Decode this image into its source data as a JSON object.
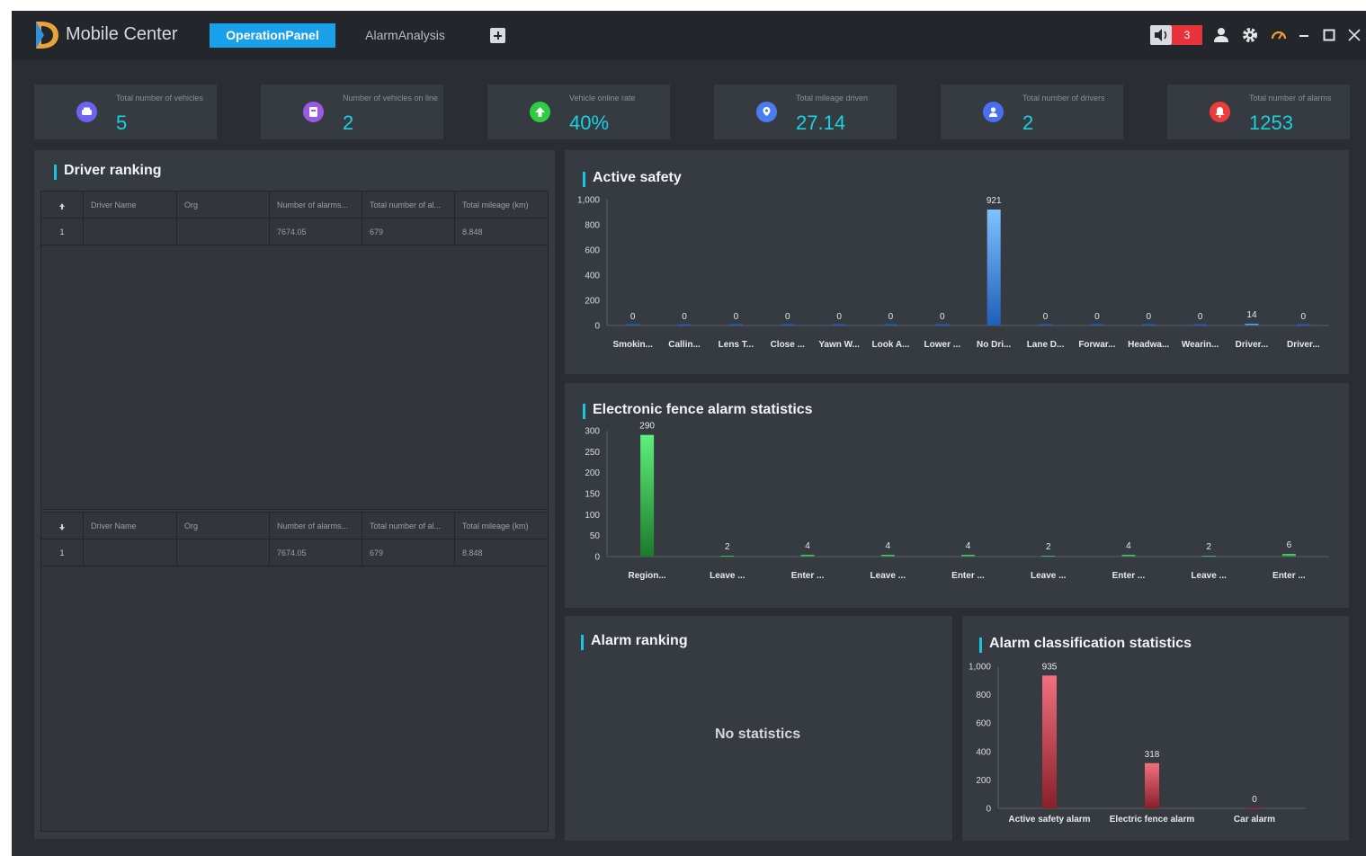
{
  "app": {
    "title": "Mobile Center"
  },
  "tabs": [
    {
      "label": "OperationPanel",
      "active": true
    },
    {
      "label": "AlarmAnalysis",
      "active": false
    }
  ],
  "system": {
    "alarm_count": "3",
    "icons": [
      "speaker-icon",
      "user-icon",
      "settings-icon",
      "gauge-icon",
      "minimize-icon",
      "maximize-icon",
      "close-icon"
    ]
  },
  "kpis": [
    {
      "label": "Total number of vehicles",
      "value": "5",
      "icon": "car-icon",
      "color": "#6c63f0"
    },
    {
      "label": "Number of vehicles on line",
      "value": "2",
      "icon": "vehicle-online-icon",
      "color": "#9b59e8"
    },
    {
      "label": "Vehicle online rate",
      "value": "40%",
      "icon": "arrow-up-icon",
      "color": "#2ecc40"
    },
    {
      "label": "Total mileage driven",
      "value": "27.14",
      "icon": "location-icon",
      "color": "#4a7cf0"
    },
    {
      "label": "Total number of drivers",
      "value": "2",
      "icon": "driver-icon",
      "color": "#4a6ef0"
    },
    {
      "label": "Total number of alarms",
      "value": "1253",
      "icon": "bell-icon",
      "color": "#ee3b3b"
    }
  ],
  "driver_ranking": {
    "title": "Driver ranking",
    "columns": [
      "Driver Name",
      "Org",
      "Number of alarms...",
      "Total number of al...",
      "Total mileage (km)"
    ],
    "top": [
      {
        "rank": "1",
        "name": "",
        "org": "",
        "alarms": "7674.05",
        "total": "679",
        "mileage": "8.848"
      }
    ],
    "bottom": [
      {
        "rank": "1",
        "name": "",
        "org": "",
        "alarms": "7674.05",
        "total": "679",
        "mileage": "8.848"
      }
    ]
  },
  "alarm_ranking": {
    "title": "Alarm ranking",
    "empty_text": "No statistics"
  },
  "chart_data": [
    {
      "id": "active-safety",
      "type": "bar",
      "title": "Active safety",
      "categories": [
        "Smokin...",
        "Callin...",
        "Lens T...",
        "Close ...",
        "Yawn W...",
        "Look A...",
        "Lower ...",
        "No Dri...",
        "Lane D...",
        "Forwar...",
        "Headwa...",
        "Wearin...",
        "Driver...",
        "Driver..."
      ],
      "values": [
        0,
        0,
        0,
        0,
        0,
        0,
        0,
        921,
        0,
        0,
        0,
        0,
        14,
        0
      ],
      "ylim": [
        0,
        1000
      ],
      "yticks": [
        "0",
        "200",
        "400",
        "600",
        "800",
        "1,000"
      ],
      "colors": {
        "top": "#7ec2ff",
        "bottom": "#1f5fb8"
      }
    },
    {
      "id": "fence-alarm",
      "type": "bar",
      "title": "Electronic fence alarm statistics",
      "categories": [
        "Region...",
        "Leave ...",
        "Enter ...",
        "Leave ...",
        "Enter ...",
        "Leave ...",
        "Enter ...",
        "Leave ...",
        "Enter ..."
      ],
      "values": [
        290,
        2,
        4,
        4,
        4,
        2,
        4,
        2,
        6
      ],
      "ylim": [
        0,
        300
      ],
      "yticks": [
        "0",
        "50",
        "100",
        "150",
        "200",
        "250",
        "300"
      ],
      "colors": {
        "top": "#5ef07a",
        "bottom": "#1c7a2c"
      }
    },
    {
      "id": "alarm-classification",
      "type": "bar",
      "title": "Alarm classification statistics",
      "categories": [
        "Active safety alarm",
        "Electric fence alarm",
        "Car alarm"
      ],
      "values": [
        935,
        318,
        0
      ],
      "ylim": [
        0,
        1000
      ],
      "yticks": [
        "0",
        "200",
        "400",
        "600",
        "800",
        "1,000"
      ],
      "colors": {
        "top": "#f0707e",
        "bottom": "#8a1f2c"
      }
    }
  ]
}
